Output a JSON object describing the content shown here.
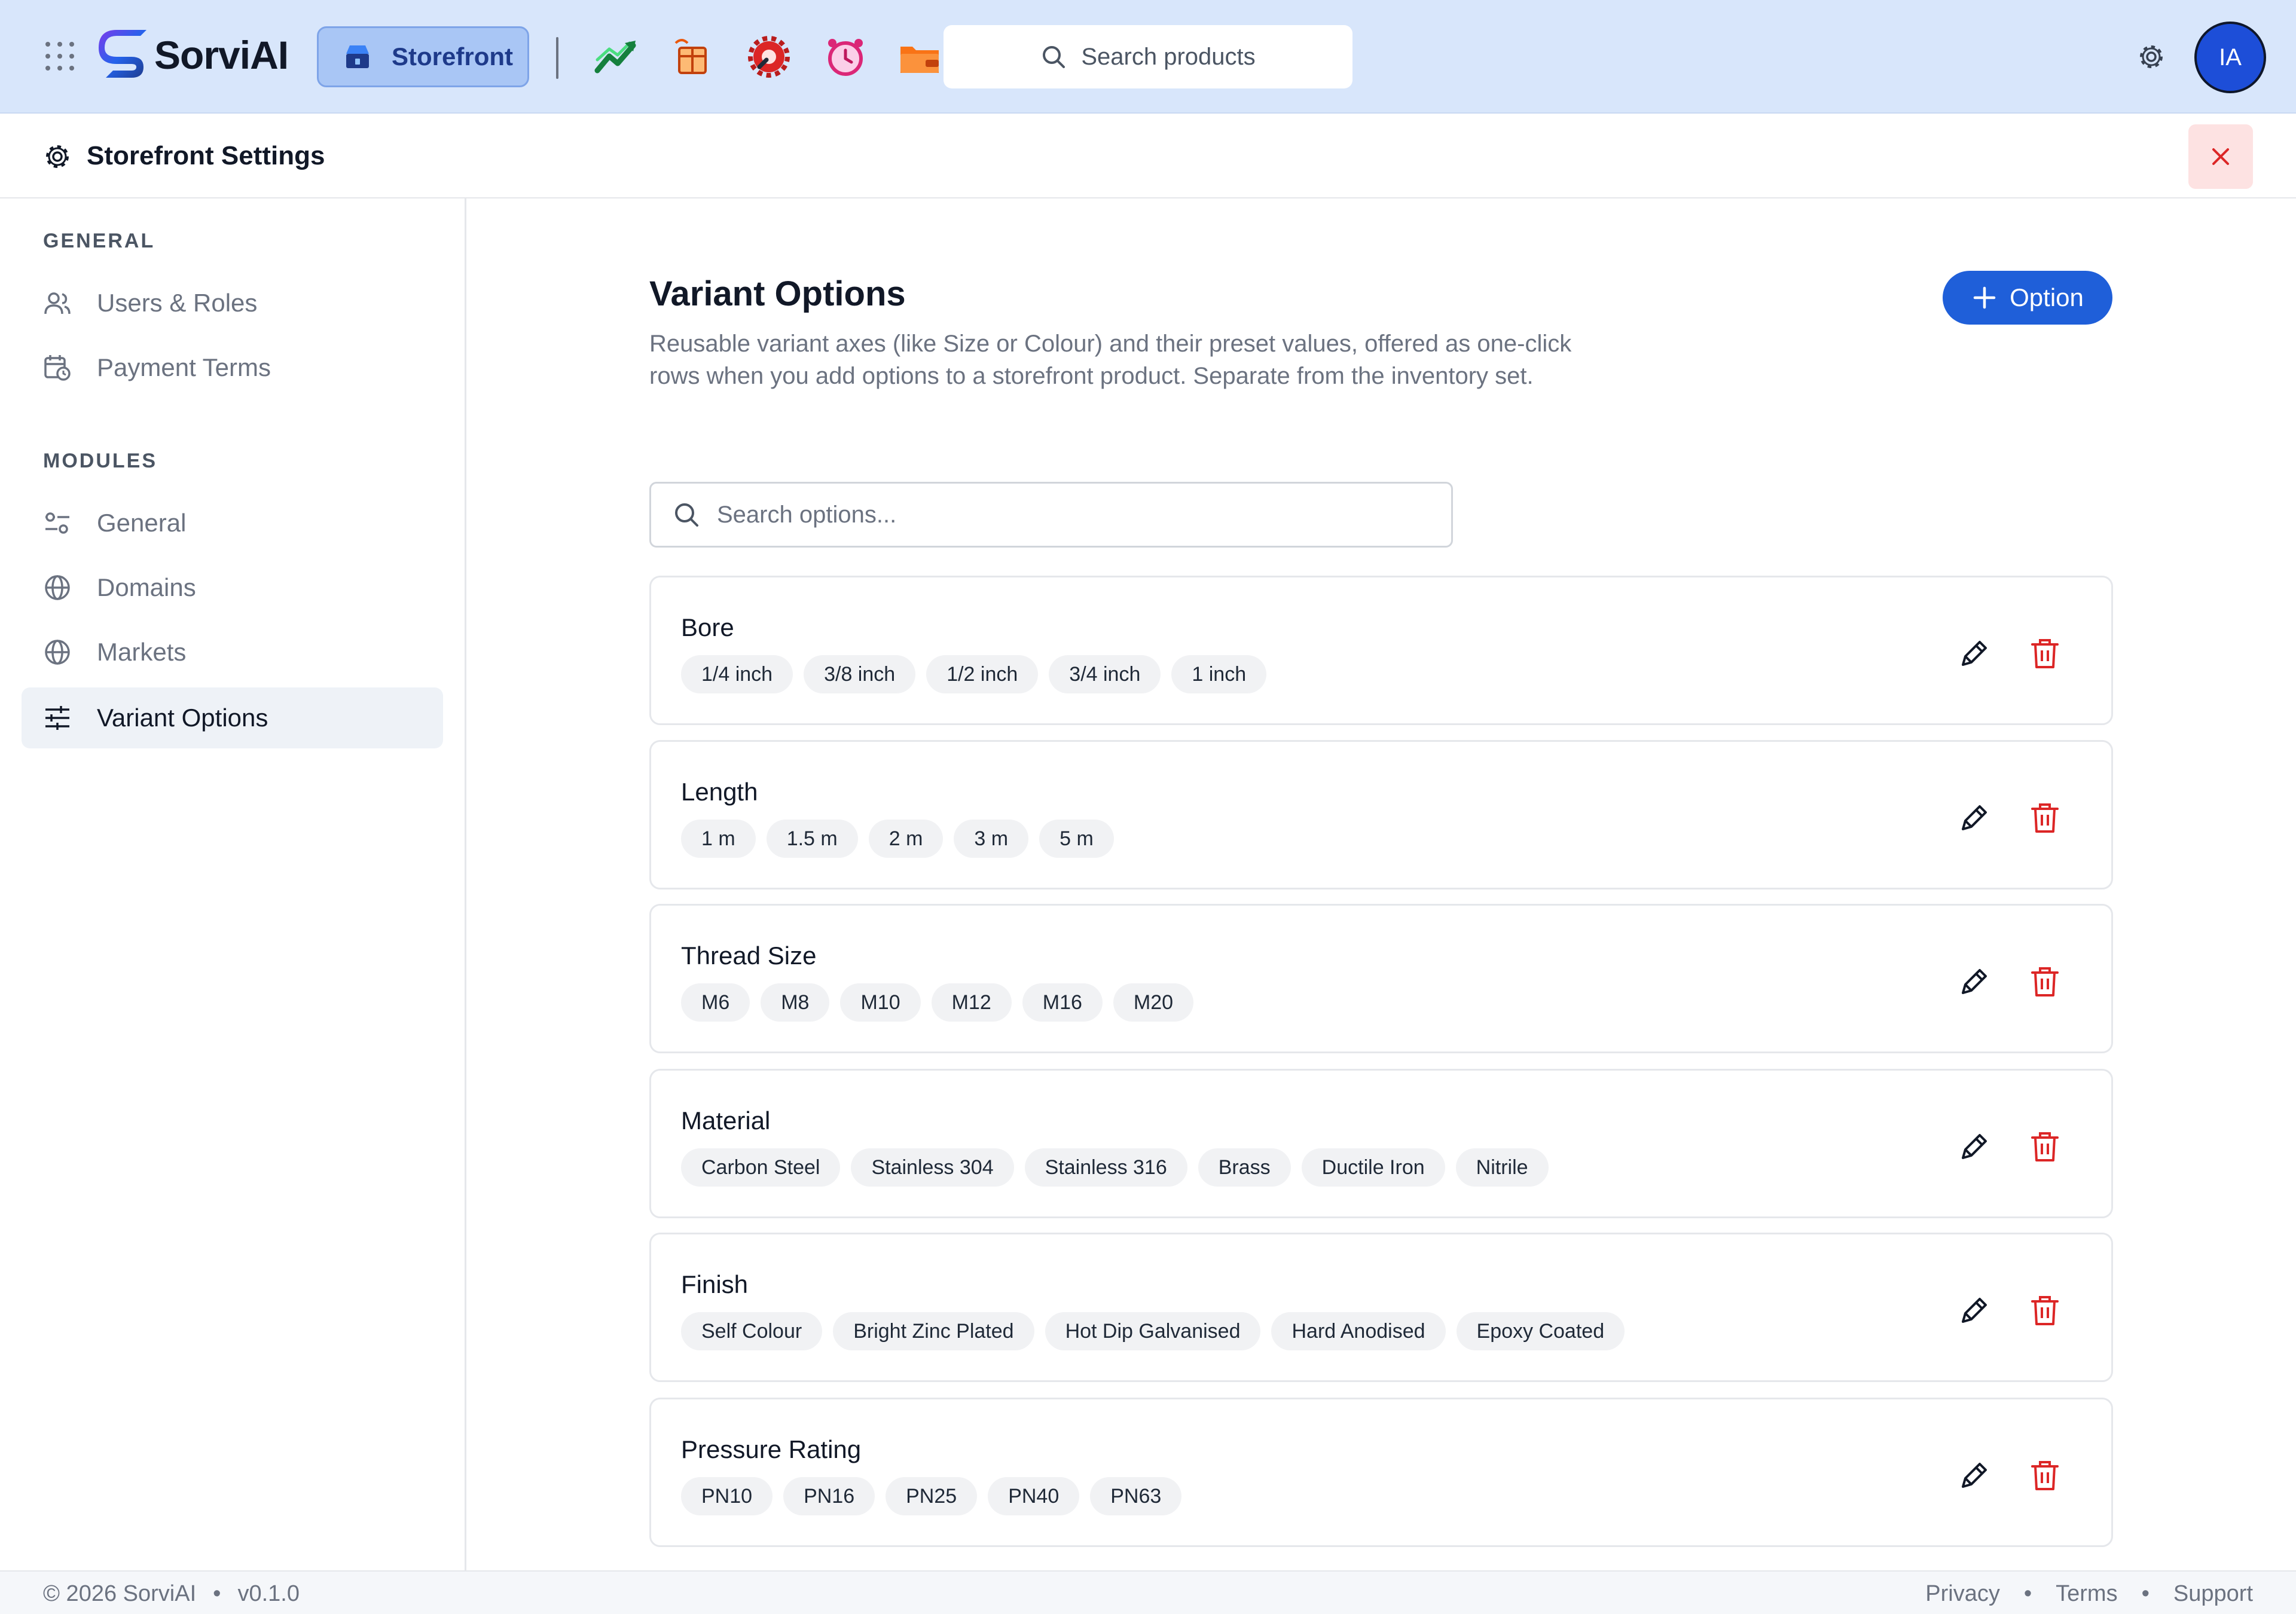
{
  "topbar": {
    "brand": "SorviAI",
    "active_app": "Storefront",
    "search_placeholder": "Search products",
    "module_icons": [
      "trend-chart-icon",
      "package-box-icon",
      "gear-wrench-icon",
      "alarm-clock-icon",
      "wallet-folder-icon"
    ],
    "avatar_initials": "IA"
  },
  "settings": {
    "title": "Storefront Settings"
  },
  "sidebar": {
    "general_label": "GENERAL",
    "general_items": [
      {
        "label": "Users & Roles",
        "icon": "users-icon"
      },
      {
        "label": "Payment Terms",
        "icon": "calendar-clock-icon"
      }
    ],
    "modules_label": "MODULES",
    "module_items": [
      {
        "label": "General",
        "icon": "sliders-icon"
      },
      {
        "label": "Domains",
        "icon": "globe-icon"
      },
      {
        "label": "Markets",
        "icon": "globe-icon"
      },
      {
        "label": "Variant Options",
        "icon": "sliders-horizontal-icon",
        "active": true
      }
    ]
  },
  "main": {
    "title": "Variant Options",
    "description": "Reusable variant axes (like Size or Colour) and their preset values, offered as one-click rows when you add options to a storefront product. Separate from the inventory set.",
    "add_button_label": "Option",
    "search_placeholder": "Search options...",
    "options": [
      {
        "name": "Bore",
        "values": [
          "1/4 inch",
          "3/8 inch",
          "1/2 inch",
          "3/4 inch",
          "1 inch"
        ]
      },
      {
        "name": "Length",
        "values": [
          "1 m",
          "1.5 m",
          "2 m",
          "3 m",
          "5 m"
        ]
      },
      {
        "name": "Thread Size",
        "values": [
          "M6",
          "M8",
          "M10",
          "M12",
          "M16",
          "M20"
        ]
      },
      {
        "name": "Material",
        "values": [
          "Carbon Steel",
          "Stainless 304",
          "Stainless 316",
          "Brass",
          "Ductile Iron",
          "Nitrile"
        ]
      },
      {
        "name": "Finish",
        "values": [
          "Self Colour",
          "Bright Zinc Plated",
          "Hot Dip Galvanised",
          "Hard Anodised",
          "Epoxy Coated"
        ]
      },
      {
        "name": "Pressure Rating",
        "values": [
          "PN10",
          "PN16",
          "PN25",
          "PN40",
          "PN63"
        ]
      }
    ]
  },
  "footer": {
    "copyright": "© 2026 SorviAI",
    "version": "v0.1.0",
    "links": [
      "Privacy",
      "Terms",
      "Support"
    ]
  },
  "colors": {
    "topbar_bg": "#d8e6fb",
    "accent": "#1f5fd9",
    "danger": "#dc2626"
  }
}
